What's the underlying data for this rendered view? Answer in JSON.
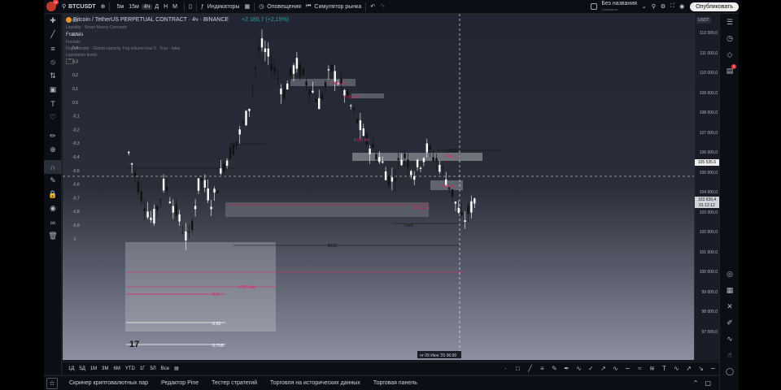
{
  "header": {
    "avatar_badge": "11",
    "symbol": "BTCUSDT",
    "timeframes": [
      "5м",
      "15м",
      "4ч",
      "Д",
      "Н",
      "М"
    ],
    "active_timeframe": "4ч",
    "indicators_label": "Индикаторы",
    "alerts_label": "Оповещения",
    "replay_label": "Симулятор рынка",
    "layout_name": "Без названия",
    "layout_sub": "Сохранить",
    "publish_label": "Опубликовать"
  },
  "legend": {
    "title": "Bitcoin / TetherUS PERPETUAL CONTRACT",
    "interval": "4ч",
    "exchange": "BINANCE",
    "change": "+2 180,7 (+2,15%)",
    "indicator1": "Fractals",
    "indicator1_sub": "Fractals",
    "indicator2": "Fvg Indicator · Global capacity, Fvg volume max 5 · True · false",
    "indicator3": "Liquidation levels",
    "indicator_faint": "Liquidity · Smart Money Concepts"
  },
  "chart": {
    "price_labels": [
      "112 000,0",
      "111 000,0",
      "110 000,0",
      "109 000,0",
      "108 000,0",
      "107 000,0",
      "106 000,0",
      "105 000,0",
      "104 000,0",
      "103 000,0",
      "102 000,0",
      "101 000,0",
      "100 000,0",
      "99 000,0",
      "98 000,0",
      "97 000,0"
    ],
    "left_labels": [
      "0,6",
      "0,5",
      "0,4",
      "0,3",
      "0,2",
      "0,1",
      "0,0",
      "-0,1",
      "-0,2",
      "-0,3",
      "-0,4",
      "-0,5",
      "-0,6",
      "-0,7",
      "-0,8",
      "-0,9",
      "-1"
    ],
    "currency": "USDT",
    "crosshair_price": "105 535,6",
    "last_price": "103 639,4",
    "countdown": "01:12:12",
    "crosshair_date": "чт 05 Июн '25",
    "crosshair_time": "06:00",
    "annotations": {
      "fvg": [
        "FVG 4h",
        "FVG 4h",
        "FVG 4h",
        "FVG 1d",
        "FVG 4h",
        "FVG 4h",
        "FVG 1d"
      ],
      "conf1": "conf",
      "conf2": "conf",
      "bos1": "BOS",
      "bos2": "BOS",
      "fib1": "0,5",
      "fib2": "0,62",
      "fib3": "0,705"
    },
    "colors": {
      "up": "#ffffff",
      "down": "#111111",
      "fvg_label": "#e91e63",
      "change": "#26a69a"
    }
  },
  "rangebar": {
    "ranges": [
      "1Д",
      "5Д",
      "1М",
      "3М",
      "6М",
      "YTD",
      "1Г",
      "5Л",
      "Все"
    ]
  },
  "footer": {
    "items": [
      "Скринер криптовалютных пар",
      "Редактор Pine",
      "Тестер стратегий",
      "Торговля на исторических данных",
      "Торговая панель"
    ]
  },
  "icons": {
    "left": [
      "crosshair-icon",
      "trend-line-icon",
      "fib-icon",
      "pattern-icon",
      "forecast-icon",
      "measure-icon",
      "text-icon",
      "heart-icon",
      "ruler-icon",
      "zoom-icon",
      "magnet-icon",
      "lock-drawing-icon",
      "lock-icon",
      "eye-icon",
      "link-icon",
      "trash-icon"
    ],
    "right": [
      "watchlist-icon",
      "alerts-clock-icon",
      "layers-icon",
      "notifications-icon",
      "target-icon",
      "calendar-icon",
      "hotlist-icon",
      "ideas-icon",
      "signals-icon",
      "bell-icon",
      "chat-icon"
    ],
    "right_badge": "1"
  }
}
